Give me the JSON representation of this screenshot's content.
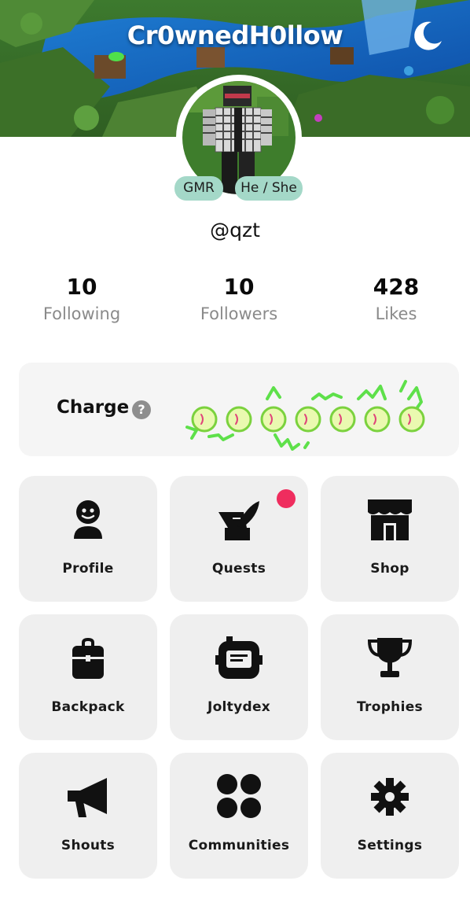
{
  "header": {
    "title": "Cr0wnedH0llow",
    "theme_toggle_icon": "moon-icon"
  },
  "profile": {
    "badges": [
      "GMR",
      "He / She"
    ],
    "handle": "@qzt",
    "badge_color": "#a4d8c8"
  },
  "stats": [
    {
      "value": "10",
      "label": "Following"
    },
    {
      "value": "10",
      "label": "Followers"
    },
    {
      "value": "428",
      "label": "Likes"
    }
  ],
  "charge": {
    "label": "Charge",
    "help": "?",
    "orbs": 7
  },
  "menu": [
    {
      "label": "Profile",
      "icon": "profile-icon"
    },
    {
      "label": "Quests",
      "icon": "quests-icon",
      "notification": true
    },
    {
      "label": "Shop",
      "icon": "shop-icon"
    },
    {
      "label": "Backpack",
      "icon": "backpack-icon"
    },
    {
      "label": "Joltydex",
      "icon": "joltydex-icon"
    },
    {
      "label": "Trophies",
      "icon": "trophy-icon"
    },
    {
      "label": "Shouts",
      "icon": "megaphone-icon"
    },
    {
      "label": "Communities",
      "icon": "communities-icon"
    },
    {
      "label": "Settings",
      "icon": "gear-icon"
    }
  ],
  "colors": {
    "notification": "#ef2d5e",
    "tile_bg": "#efefef",
    "charge_green": "#5ee04a"
  }
}
